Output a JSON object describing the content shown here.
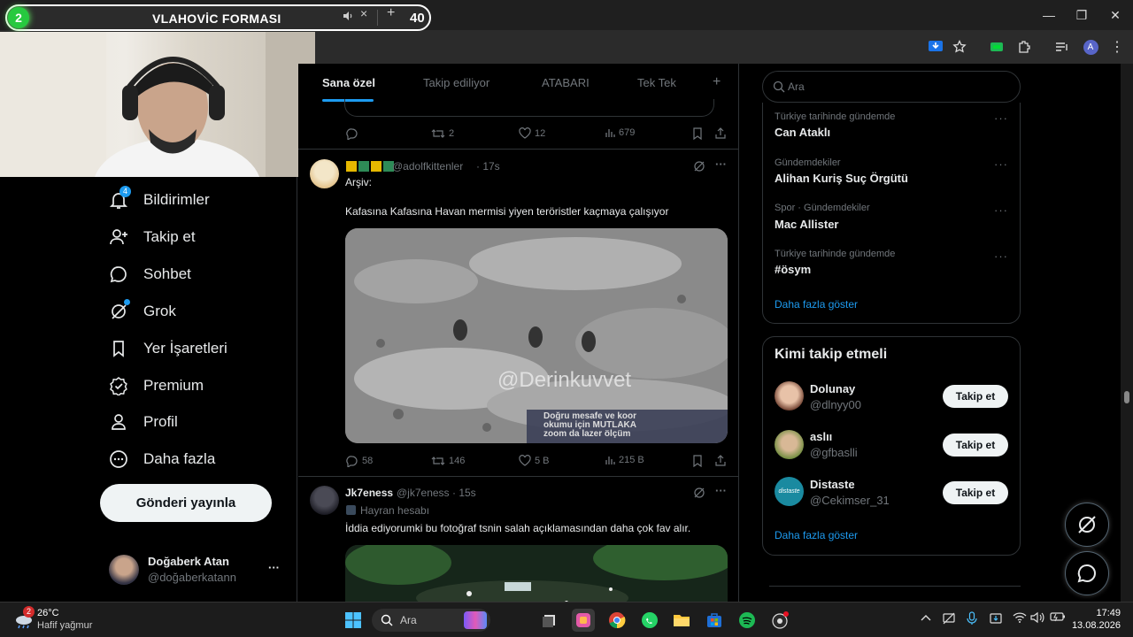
{
  "overlay": {
    "badge": "2",
    "title": "VLAHOVİC FORMASI",
    "count": "40",
    "plus": "+",
    "close": "×"
  },
  "window": {
    "minimize": "—",
    "maximize": "❐",
    "close": "✕"
  },
  "toolbar": {
    "profile_initial": "A"
  },
  "nav": {
    "notifications_badge": "4",
    "items": [
      {
        "label": "Bildirimler"
      },
      {
        "label": "Takip et"
      },
      {
        "label": "Sohbet"
      },
      {
        "label": "Grok"
      },
      {
        "label": "Yer İşaretleri"
      },
      {
        "label": "Premium"
      },
      {
        "label": "Profil"
      },
      {
        "label": "Daha fazla"
      }
    ],
    "post_button": "Gönderi yayınla",
    "user": {
      "name": "Doğaberk Atan",
      "handle": "@doğaberkatann",
      "more": "···"
    }
  },
  "feed": {
    "tabs": [
      {
        "label": "Sana özel"
      },
      {
        "label": "Takip ediliyor"
      },
      {
        "label": "ATABARI"
      },
      {
        "label": "Tek Tek"
      }
    ],
    "add_tab": "+",
    "top_post_actions": {
      "reply": "",
      "retweet": "2",
      "like": "12",
      "views": "679"
    },
    "post1": {
      "handle": "@adolfkittenler",
      "time": "· 17s",
      "line1": "Arşiv:",
      "text": "Kafasına Kafasına Havan mermisi yiyen teröristler kaçmaya çalışıyor",
      "video_watermark": "@Derinkuvvet",
      "video_caption": [
        "Doğru mesafe ve koor",
        "okumu için MUTLAKA",
        "zoom da lazer ölçüm"
      ],
      "actions": {
        "reply": "58",
        "retweet": "146",
        "like": "5 B",
        "views": "215 B"
      }
    },
    "post2": {
      "name": "Jk7eness",
      "handle": "@jk7eness",
      "time": "· 15s",
      "label": "Hayran hesabı",
      "text": "İddia ediyorumki bu fotoğraf tsnin salah açıklamasından daha çok fav alır."
    }
  },
  "right": {
    "search_placeholder": "Ara",
    "trends": [
      {
        "meta": "Türkiye tarihinde gündemde",
        "name": "Can Ataklı"
      },
      {
        "meta": "Gündemdekiler",
        "name": "Alihan Kuriş Suç Örgütü"
      },
      {
        "meta": "Spor · Gündemdekiler",
        "name": "Mac Allister"
      },
      {
        "meta": "Türkiye tarihinde gündemde",
        "name": "#ösym"
      }
    ],
    "trends_more": "Daha fazla göster",
    "who_title": "Kimi takip etmeli",
    "who": [
      {
        "name": "Dolunay",
        "handle": "@dlnyy00",
        "button": "Takip et"
      },
      {
        "name": "aslıı",
        "handle": "@gfbaslli",
        "button": "Takip et"
      },
      {
        "name": "Distaste",
        "handle": "@Cekimser_31",
        "button": "Takip et",
        "avatar_text": "distaste"
      }
    ],
    "who_more": "Daha fazla göster",
    "dots": "···"
  },
  "taskbar": {
    "weather_temp": "26°C",
    "weather_desc": "Hafif yağmur",
    "weather_badge": "2",
    "search_label": "Ara",
    "time": "17:49",
    "date": "13.08.2026"
  },
  "colors": {
    "accent": "#1d9bf0",
    "link": "#1d9bf0",
    "muted": "#71767b",
    "text": "#e7e9ea"
  }
}
